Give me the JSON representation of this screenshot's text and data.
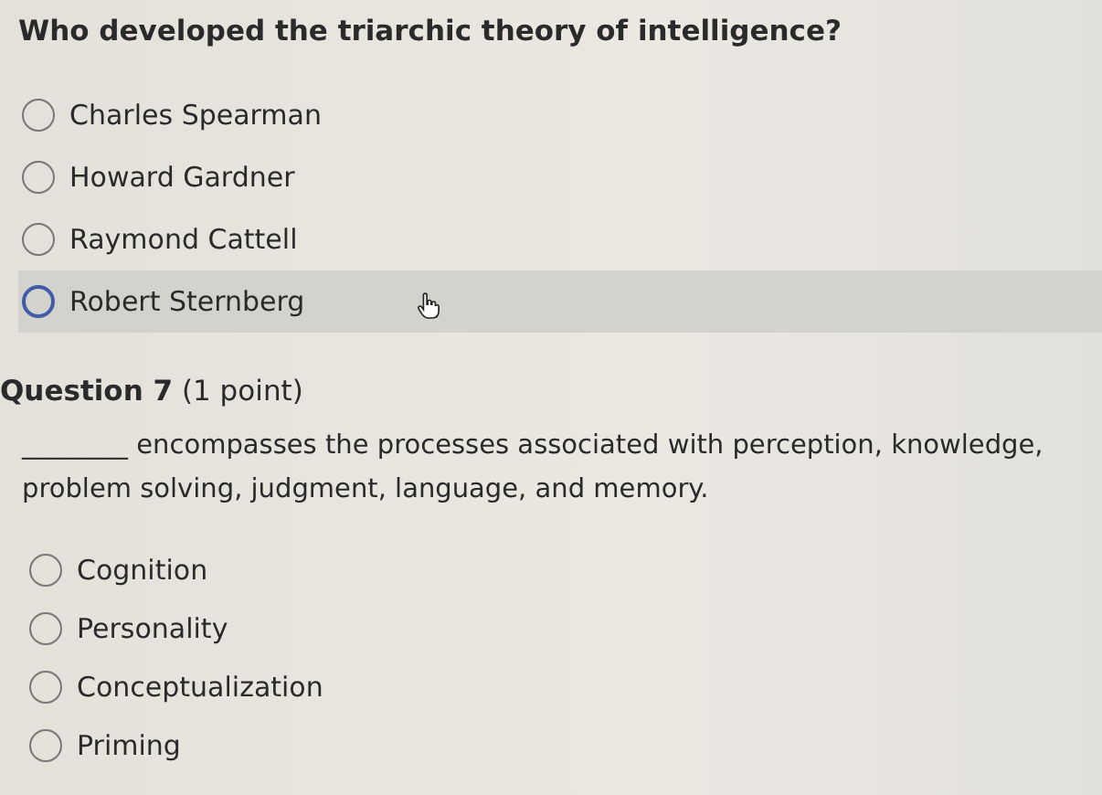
{
  "questions": [
    {
      "prompt": "Who developed the triarchic theory of intelligence?",
      "options": [
        {
          "label": "Charles Spearman",
          "hovered": false,
          "selected": false
        },
        {
          "label": "Howard Gardner",
          "hovered": false,
          "selected": false
        },
        {
          "label": "Raymond Cattell",
          "hovered": false,
          "selected": false
        },
        {
          "label": "Robert Sternberg",
          "hovered": true,
          "selected": false
        }
      ]
    },
    {
      "heading": "**Question 7** (1 point)",
      "prompt": "________ encompasses the processes associated with perception, knowledge, problem solving, judgment, language, and memory.",
      "options": [
        {
          "label": "Cognition",
          "hovered": false,
          "selected": false
        },
        {
          "label": "Personality",
          "hovered": false,
          "selected": false
        },
        {
          "label": "Conceptualization",
          "hovered": false,
          "selected": false
        },
        {
          "label": "Priming",
          "hovered": false,
          "selected": false
        }
      ]
    }
  ]
}
